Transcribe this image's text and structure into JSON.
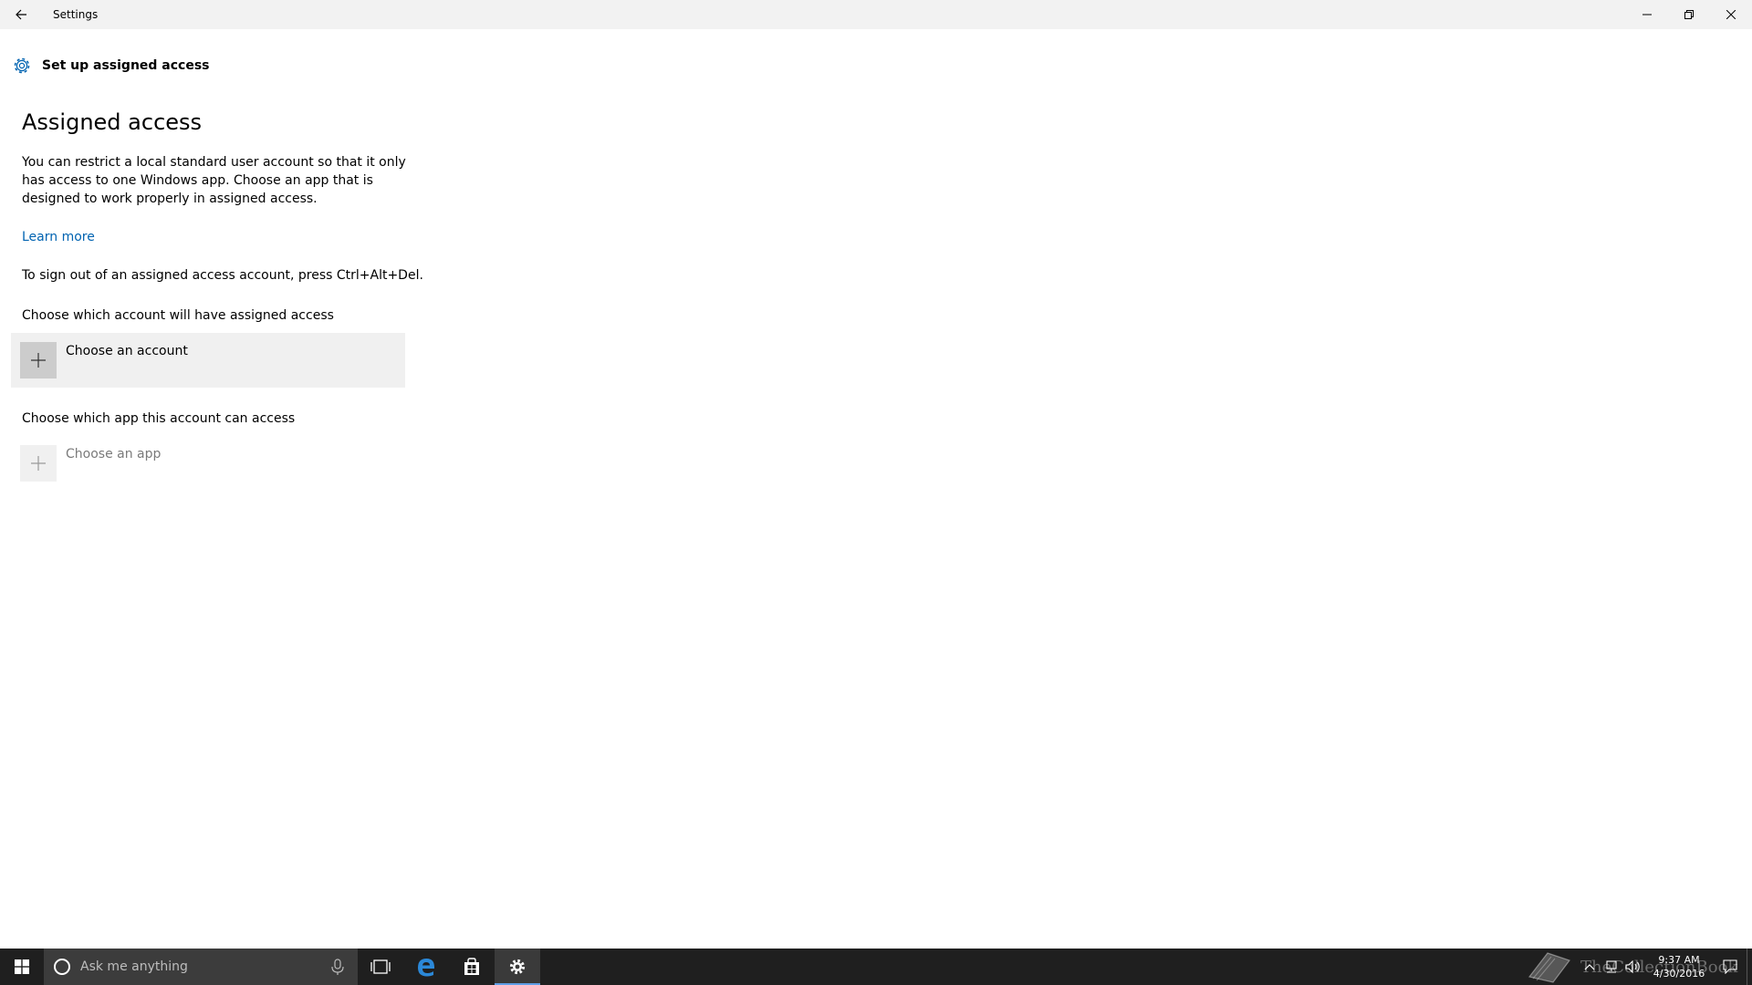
{
  "titlebar": {
    "title": "Settings"
  },
  "header": {
    "title": "Set up assigned access"
  },
  "main": {
    "heading": "Assigned access",
    "description": "You can restrict a local standard user account so that it only has access to one Windows app. Choose an app that is designed to work properly in assigned access.",
    "learn_more": "Learn more",
    "signout_text": "To sign out of an assigned access account, press Ctrl+Alt+Del.",
    "account_label": "Choose which account will have assigned access",
    "account_button": "Choose an account",
    "app_label": "Choose which app this account can access",
    "app_button": "Choose an app"
  },
  "taskbar": {
    "search_placeholder": "Ask me anything",
    "clock_time": "9:37 AM",
    "clock_date": "4/30/2016"
  },
  "watermark": {
    "text": "TheCollectionBook"
  },
  "colors": {
    "accent": "#0063b1",
    "taskbar": "#1f1f1f",
    "titlebar": "#f2f2f2",
    "tile": "#f0f0f0"
  }
}
